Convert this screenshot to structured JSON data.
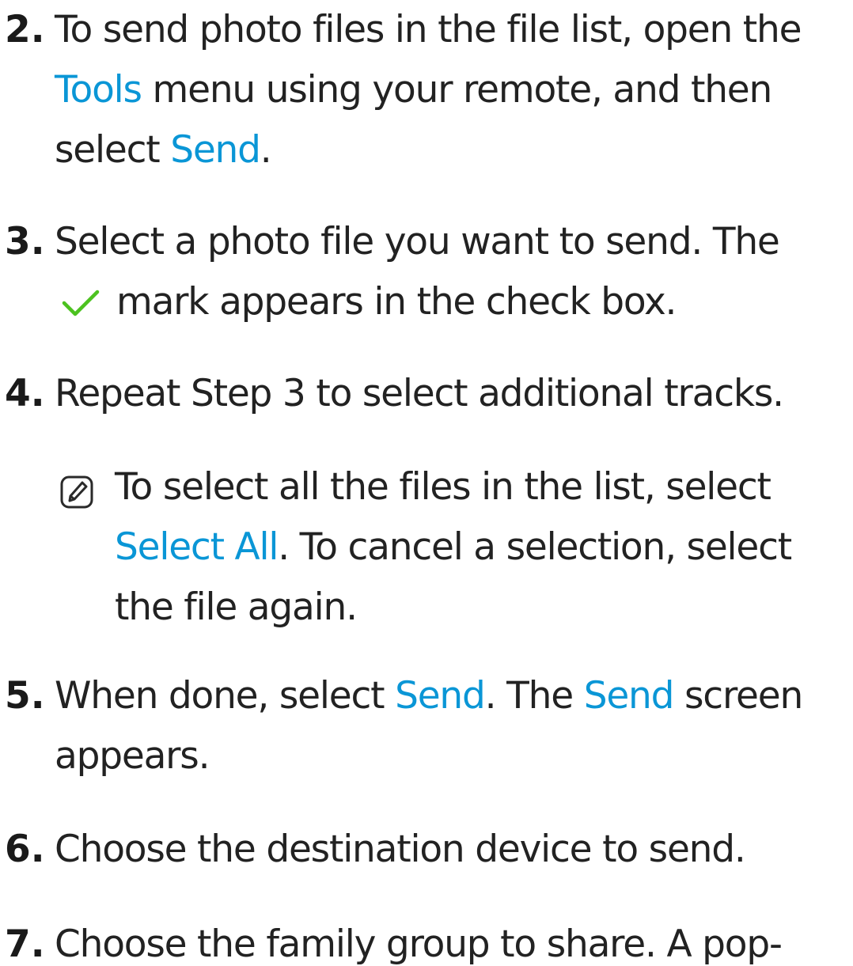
{
  "steps": [
    {
      "number": "2.",
      "parts": [
        {
          "text": "To send photo files in the file list, open the "
        },
        {
          "text": "Tools",
          "highlight": true
        },
        {
          "text": " menu using your remote, and then select "
        },
        {
          "text": "Send",
          "highlight": true
        },
        {
          "text": "."
        }
      ]
    },
    {
      "number": "3.",
      "line1": "Select a photo file you want to send. The",
      "check_icon": "checkmark-icon",
      "line2": "mark appears in the check box."
    },
    {
      "number": "4.",
      "text": "Repeat Step 3 to select additional tracks."
    },
    {
      "note_icon": "note-pencil-icon",
      "note_parts": [
        {
          "text": "To select all the files in the list, select "
        },
        {
          "text": "Select All",
          "highlight": true
        },
        {
          "text": ". To cancel a selection, select the file again."
        }
      ]
    },
    {
      "number": "5.",
      "parts": [
        {
          "text": "When done, select "
        },
        {
          "text": "Send",
          "highlight": true
        },
        {
          "text": ". The "
        },
        {
          "text": "Send",
          "highlight": true
        },
        {
          "text": " screen appears."
        }
      ]
    },
    {
      "number": "6.",
      "text": "Choose the destination device to send."
    },
    {
      "number": "7.",
      "text": "Choose the family group to share. A pop-"
    }
  ],
  "colors": {
    "highlight": "#0a96d6",
    "text": "#222222",
    "check": "#4cc21f"
  }
}
